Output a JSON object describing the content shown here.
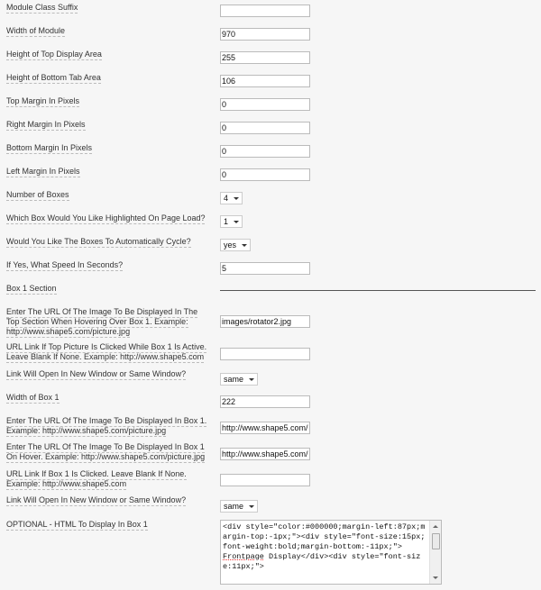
{
  "fields": [
    {
      "label": "Module Class Suffix",
      "value": ""
    },
    {
      "label": "Width of Module",
      "value": "970"
    },
    {
      "label": "Height of Top Display Area",
      "value": "255"
    },
    {
      "label": "Height of Bottom Tab Area",
      "value": "106"
    },
    {
      "label": "Top Margin In Pixels",
      "value": "0"
    },
    {
      "label": "Right Margin In Pixels",
      "value": "0"
    },
    {
      "label": "Bottom Margin In Pixels",
      "value": "0"
    },
    {
      "label": "Left Margin In Pixels",
      "value": "0"
    },
    {
      "label": "Number of Boxes",
      "value": "4"
    },
    {
      "label": "Which Box Would You Like Highlighted On Page Load?",
      "value": "1"
    },
    {
      "label": "Would You Like The Boxes To Automatically Cycle?",
      "value": "yes"
    },
    {
      "label": "If Yes, What Speed In Seconds?",
      "value": "5"
    },
    {
      "label": "Box 1 Section"
    },
    {
      "label": "Enter The URL Of The Image To Be Displayed In The Top Section When Hovering Over Box 1. Example: http://www.shape5.com/picture.jpg",
      "value": "images/rotator2.jpg"
    },
    {
      "label": "URL Link If Top Picture Is Clicked While Box 1 Is Active. Leave Blank If None. Example: http://www.shape5.com",
      "value": ""
    },
    {
      "label": "Link Will Open In New Window or Same Window?",
      "value": "same"
    },
    {
      "label": "Width of Box 1",
      "value": "222"
    },
    {
      "label": "Enter The URL Of The Image To Be Displayed In Box 1. Example: http://www.shape5.com/picture.jpg",
      "value": "http://www.shape5.com/"
    },
    {
      "label": "Enter The URL Of The Image To Be Displayed In Box 1 On Hover. Example: http://www.shape5.com/picture.jpg",
      "value": "http://www.shape5.com/"
    },
    {
      "label": "URL Link If Box 1 Is Clicked. Leave Blank If None. Example: http://www.shape5.com",
      "value": ""
    },
    {
      "label": "Link Will Open In New Window or Same Window?",
      "value": "same"
    },
    {
      "label": "OPTIONAL - HTML To Display In Box 1",
      "value_before": "<div style=\"color:#000000;margin-left:87px;margin-top:-1px;\"><div style=\"font-size:15px;font-weight:bold;margin-bottom:-11px;\">\n",
      "value_spell": "Frontpage",
      "value_after": " Display</div><div style=\"font-size:11px;\">"
    }
  ]
}
